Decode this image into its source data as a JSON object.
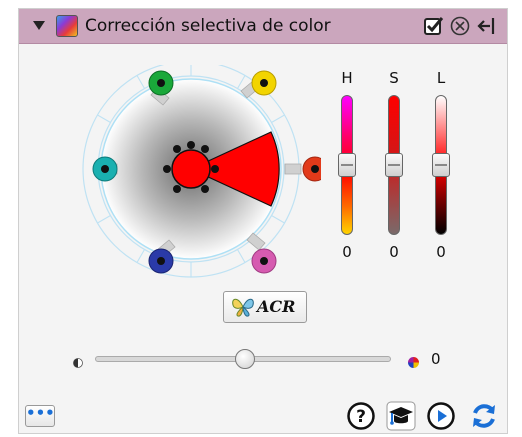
{
  "panel": {
    "title": "Corrección selectiva de color",
    "icons": {
      "collapse": "triangle-down-icon",
      "app": "color-correction-icon",
      "enable": "checkbox-checked-icon",
      "close": "close-circle-icon",
      "exit": "exit-arrow-icon"
    }
  },
  "color_wheel": {
    "selected_hue_color": "#ff0000",
    "handles": [
      {
        "name": "green",
        "color": "#1aa83a"
      },
      {
        "name": "yellow",
        "color": "#f2d400"
      },
      {
        "name": "red",
        "color": "#e23a1a"
      },
      {
        "name": "magenta",
        "color": "#d65bb0"
      },
      {
        "name": "blue",
        "color": "#2a3aa8"
      },
      {
        "name": "cyan",
        "color": "#1ab0b0"
      }
    ]
  },
  "hsl": {
    "h": {
      "label": "H",
      "value": "0"
    },
    "s": {
      "label": "S",
      "value": "0"
    },
    "l": {
      "label": "L",
      "value": "0"
    }
  },
  "acr_button": {
    "label": "ACR",
    "icon": "butterfly-icon"
  },
  "amount_slider": {
    "value": "0",
    "position_fraction": 0.5
  },
  "bottom_toolbar": {
    "more_label": "•••",
    "icons": [
      "help-icon",
      "graduation-cap-icon",
      "play-icon",
      "refresh-icon"
    ]
  }
}
